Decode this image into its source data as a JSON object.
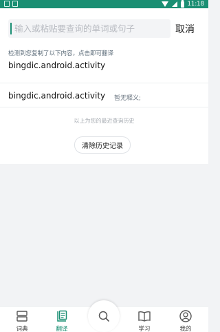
{
  "status_bar": {
    "time": "11:18"
  },
  "search": {
    "placeholder": "输入或粘贴要查询的单词或句子",
    "cancel_label": "取消"
  },
  "clipboard": {
    "hint": "检测到您复制了以下内容，点击即可翻译",
    "text": "bingdic.android.activity"
  },
  "history": {
    "items": [
      {
        "word": "bingdic.android.activity",
        "definition": "暂无释义;"
      }
    ],
    "caption": "以上为您的最近查询历史",
    "clear_label": "清除历史记录"
  },
  "nav": {
    "items": [
      {
        "label": "词典",
        "icon": "dictionary-icon"
      },
      {
        "label": "翻译",
        "icon": "translate-icon",
        "active": true
      },
      {
        "label": "",
        "icon": "search-icon"
      },
      {
        "label": "学习",
        "icon": "book-icon"
      },
      {
        "label": "我的",
        "icon": "profile-icon"
      }
    ]
  },
  "colors": {
    "accent": "#1a8f73",
    "background": "#f2f3f5"
  }
}
